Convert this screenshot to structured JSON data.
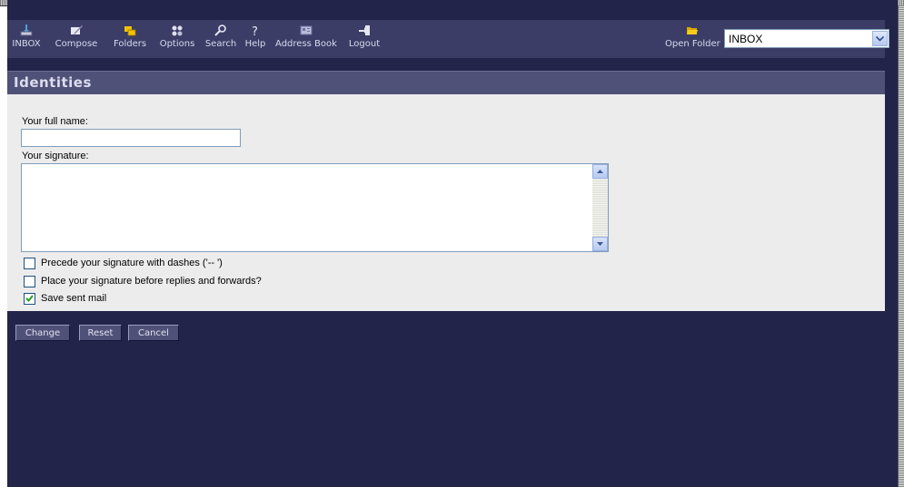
{
  "toolbar": {
    "items": [
      {
        "label": "INBOX",
        "icon": "inbox-icon"
      },
      {
        "label": "Compose",
        "icon": "compose-icon"
      },
      {
        "label": "Folders",
        "icon": "folders-icon"
      },
      {
        "label": "Options",
        "icon": "options-icon"
      },
      {
        "label": "Search",
        "icon": "search-icon"
      },
      {
        "label": "Help",
        "icon": "help-icon"
      },
      {
        "label": "Address Book",
        "icon": "address-book-icon"
      },
      {
        "label": "Logout",
        "icon": "logout-icon"
      }
    ],
    "open_folder_label": "Open Folder",
    "folder_select_value": "INBOX"
  },
  "section": {
    "title": "Identities"
  },
  "form": {
    "full_name_label": "Your full name:",
    "full_name_value": "",
    "signature_label": "Your signature:",
    "signature_value": "",
    "options": [
      {
        "label": "Precede your signature with dashes ('-- ')",
        "checked": false
      },
      {
        "label": "Place your signature before replies and forwards?",
        "checked": false
      },
      {
        "label": "Save sent mail",
        "checked": true
      }
    ]
  },
  "buttons": {
    "change": "Change",
    "reset": "Reset",
    "cancel": "Cancel"
  },
  "colors": {
    "background": "#23244a",
    "toolbar": "#3c3d66",
    "panel": "#ececec",
    "section_header": "#505178"
  }
}
